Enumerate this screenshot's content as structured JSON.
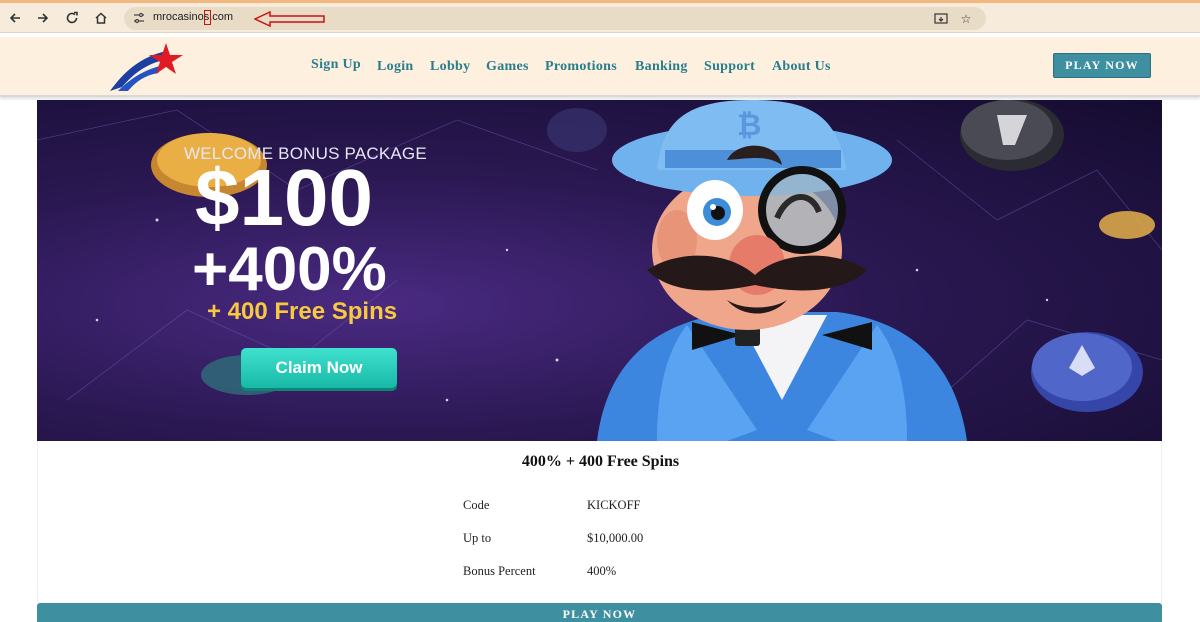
{
  "browser": {
    "url": "mrocasinos.com",
    "icons": {
      "back": "arrow-left-icon",
      "forward": "arrow-right-icon",
      "reload": "reload-icon",
      "home": "home-icon",
      "site_info": "site-info-icon",
      "install": "install-app-icon",
      "bookmark": "star-icon"
    }
  },
  "header": {
    "nav": [
      "Sign Up",
      "Login",
      "Lobby",
      "Games",
      "Promotions",
      "Banking",
      "Support",
      "About Us"
    ],
    "play_now": "PLAY NOW",
    "colors": {
      "background": "#fdf0df",
      "link": "#2a7d8c",
      "button": "#3e8fa0"
    }
  },
  "banner": {
    "welcome": "WELCOME BONUS PACKAGE",
    "amount": "$100",
    "percent": "+400%",
    "spins": "+ 400 Free Spins",
    "claim": "Claim Now",
    "colors": {
      "spins": "#f8c840",
      "claim": "#22c7b3"
    }
  },
  "offer": {
    "title": "400% + 400 Free Spins",
    "rows": [
      {
        "label": "Code",
        "value": "KICKOFF"
      },
      {
        "label": "Up to",
        "value": "$10,000.00"
      },
      {
        "label": "Bonus Percent",
        "value": "400%"
      }
    ],
    "play_now": "PLAY NOW"
  }
}
